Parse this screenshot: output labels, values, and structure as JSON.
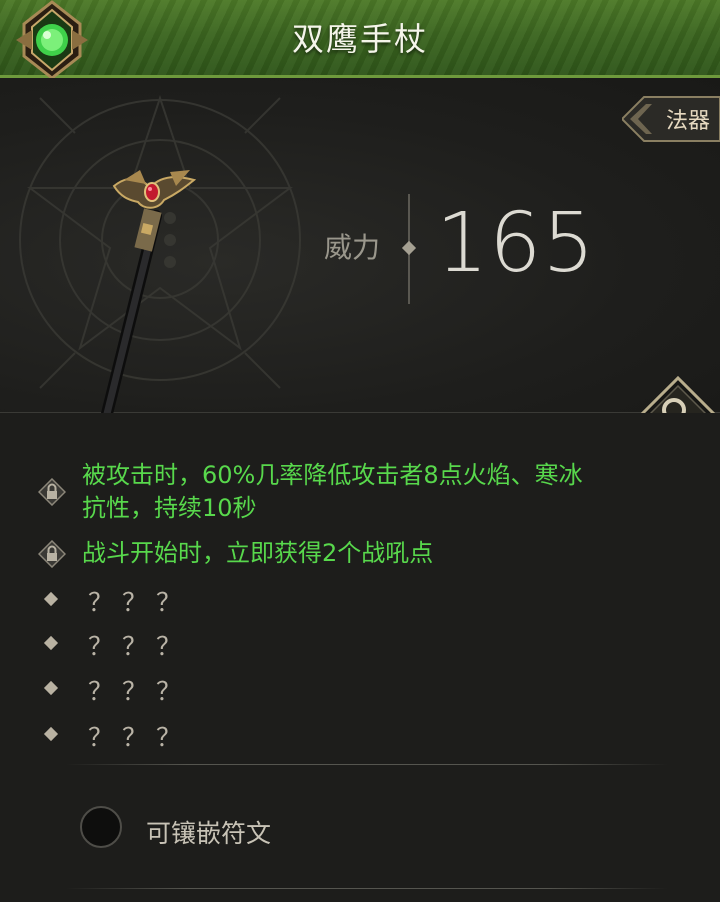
{
  "window": {
    "title": "双鹰手杖"
  },
  "item": {
    "category": "法器",
    "power_label": "威力",
    "power_value": "165"
  },
  "attributes": [
    {
      "locked": true,
      "text_line1": "被攻击时，60%几率降低攻击者8点火焰、寒冰",
      "text_line2": "抗性，持续10秒"
    },
    {
      "locked": true,
      "text_line1": "战斗开始时，立即获得2个战吼点"
    }
  ],
  "unknown_attributes": [
    "？？？",
    "？？？",
    "？？？",
    "？？？"
  ],
  "rune_socket": {
    "label": "可镶嵌符文"
  },
  "colors": {
    "header_green": "#3c6620",
    "attribute_green": "#58d84c",
    "background": "#1c1c1a"
  },
  "icons": {
    "emblem": "green-gem-emblem-icon",
    "inspect": "magnifier-icon",
    "lock": "lock-icon",
    "staff": "double-eagle-staff-image"
  }
}
